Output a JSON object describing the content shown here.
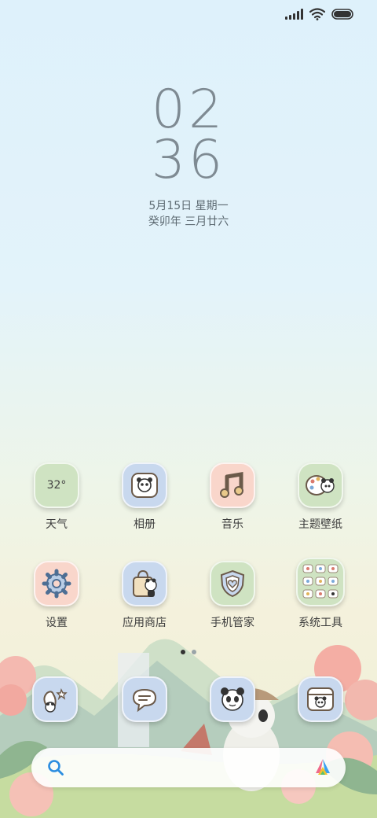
{
  "clock": {
    "hour": "02",
    "minute": "36"
  },
  "date": {
    "gregorian": "5月15日 星期一",
    "lunar": "癸卯年 三月廿六"
  },
  "weather": {
    "temp": "32°"
  },
  "apps": [
    {
      "label": "天气"
    },
    {
      "label": "相册"
    },
    {
      "label": "音乐"
    },
    {
      "label": "主题壁纸"
    },
    {
      "label": "设置"
    },
    {
      "label": "应用商店"
    },
    {
      "label": "手机管家"
    },
    {
      "label": "系统工具"
    }
  ],
  "pager": {
    "pages": 2,
    "current": 1
  },
  "colors": {
    "accent": "#2b8de0",
    "text": "#3e3e3e",
    "icon_green": "#cfe3c2",
    "icon_blue": "#c8d8ee",
    "icon_pink": "#f9d6cb"
  }
}
